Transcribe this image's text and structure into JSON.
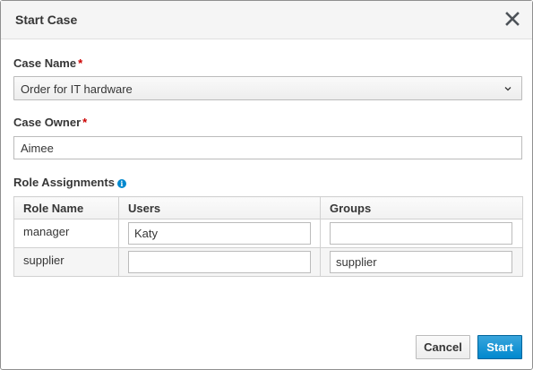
{
  "dialog": {
    "title": "Start Case",
    "close_icon": "close-icon"
  },
  "case_name": {
    "label": "Case Name",
    "required_mark": "*",
    "selected": "Order for IT hardware",
    "chevron_icon": "chevron-down-icon"
  },
  "case_owner": {
    "label": "Case Owner",
    "required_mark": "*",
    "value": "Aimee"
  },
  "role_assignments": {
    "label": "Role Assignments",
    "info_icon": "info-icon",
    "columns": [
      "Role Name",
      "Users",
      "Groups"
    ],
    "rows": [
      {
        "role": "manager",
        "users": "Katy",
        "groups": ""
      },
      {
        "role": "supplier",
        "users": "",
        "groups": "supplier"
      }
    ]
  },
  "buttons": {
    "cancel": "Cancel",
    "start": "Start"
  },
  "colors": {
    "primary": "#0088ce",
    "required": "#cc0000",
    "header_bg": "#f5f5f5"
  }
}
